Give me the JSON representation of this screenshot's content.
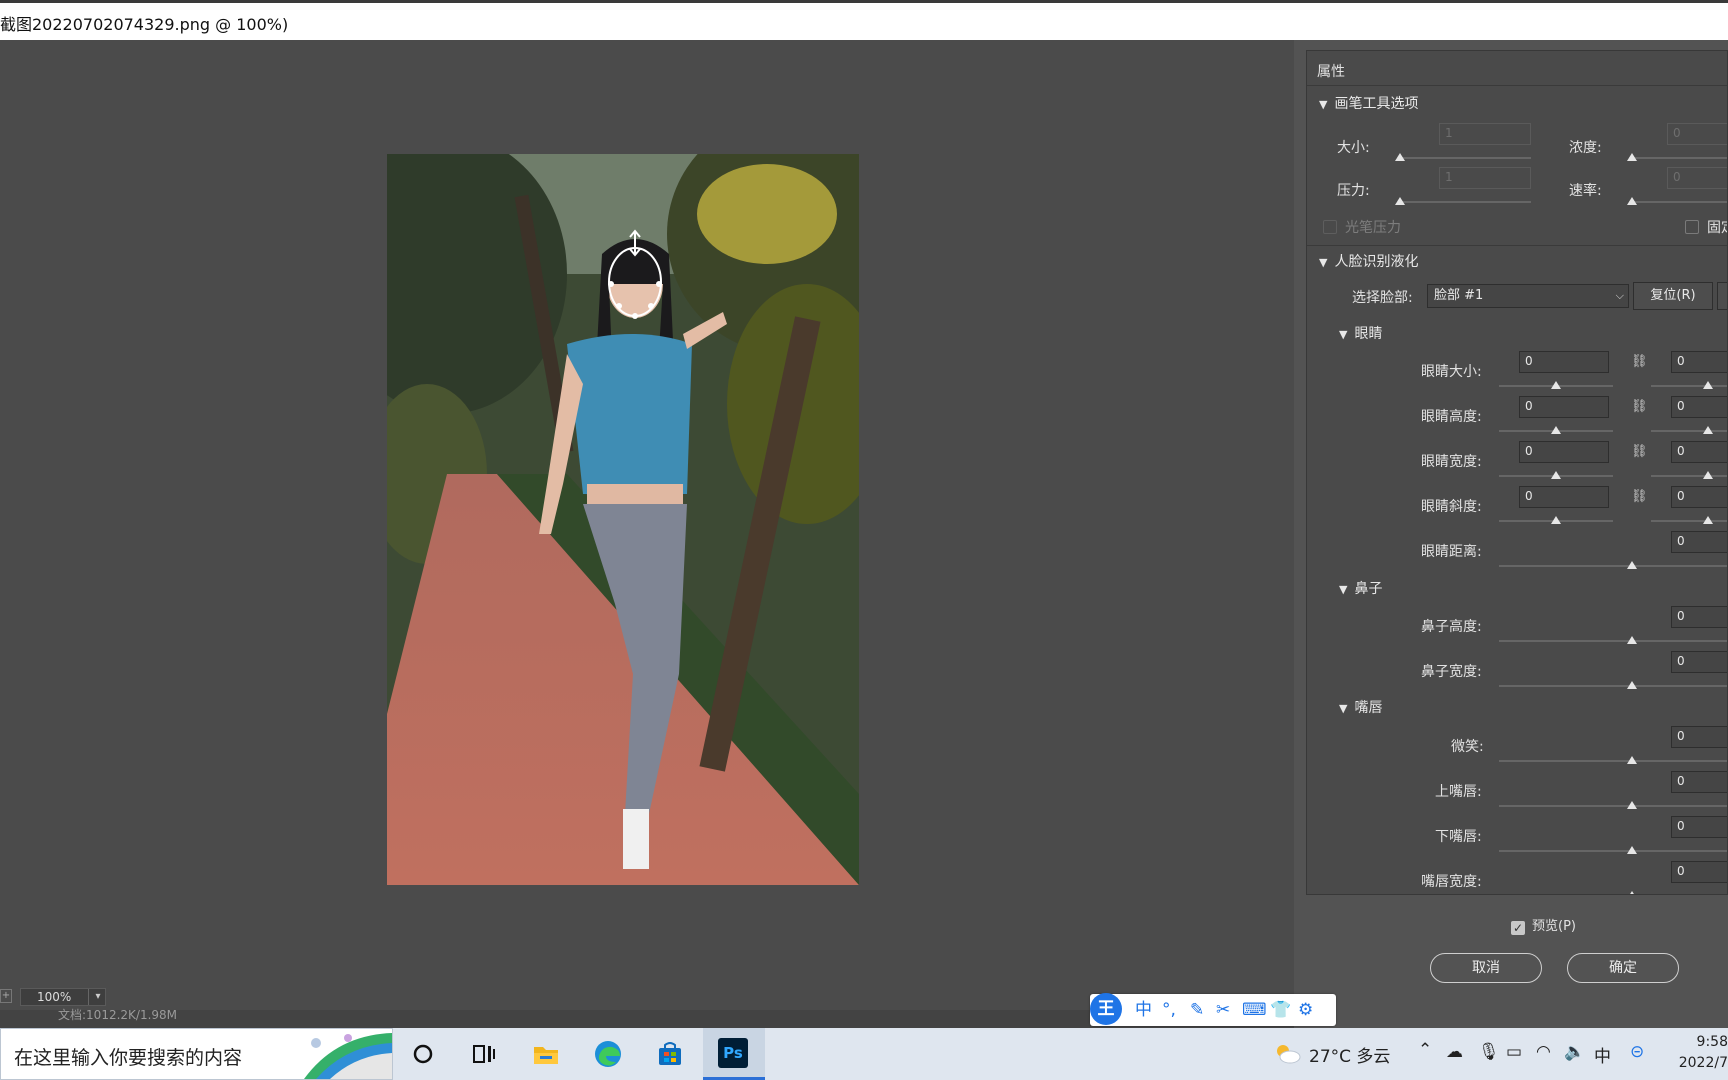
{
  "window": {
    "title": "截图20220702074329.png @ 100%)"
  },
  "canvas": {
    "zoom": "100%",
    "doc_status": "文档:1012.2K/1.98M"
  },
  "panel": {
    "header": "属性",
    "brush_section": {
      "title": "画笔工具选项",
      "size_label": "大小:",
      "size_value": "1",
      "density_label": "浓度:",
      "density_value": "0",
      "pressure_label": "压力:",
      "pressure_value": "1",
      "rate_label": "速率:",
      "rate_value": "0",
      "stylus_pressure": "光笔压力",
      "pin_label": "固定"
    },
    "face_section": {
      "title": "人脸识别液化",
      "select_face_label": "选择脸部:",
      "select_face_value": "脸部 #1",
      "reset_label": "复位(R)"
    },
    "eyes": {
      "title": "眼睛",
      "rows": [
        {
          "label": "眼睛大小:",
          "left": "0",
          "right": "0"
        },
        {
          "label": "眼睛高度:",
          "left": "0",
          "right": "0"
        },
        {
          "label": "眼睛宽度:",
          "left": "0",
          "right": "0"
        },
        {
          "label": "眼睛斜度:",
          "left": "0",
          "right": "0"
        }
      ],
      "distance_label": "眼睛距离:",
      "distance_value": "0"
    },
    "nose": {
      "title": "鼻子",
      "rows": [
        {
          "label": "鼻子高度:",
          "value": "0"
        },
        {
          "label": "鼻子宽度:",
          "value": "0"
        }
      ]
    },
    "mouth": {
      "title": "嘴唇",
      "rows": [
        {
          "label": "微笑:",
          "value": "0"
        },
        {
          "label": "上嘴唇:",
          "value": "0"
        },
        {
          "label": "下嘴唇:",
          "value": "0"
        },
        {
          "label": "嘴唇宽度:",
          "value": "0"
        }
      ]
    }
  },
  "dialog": {
    "preview_label": "预览(P)",
    "preview_checked": true,
    "cancel_label": "取消",
    "ok_label": "确定"
  },
  "ime": {
    "logo": "王",
    "lang": "中"
  },
  "taskbar": {
    "search_placeholder": "在这里输入你要搜索的内容",
    "ps_label": "Ps",
    "weather": "27°C 多云",
    "ime_indicator": "中",
    "time": "9:58",
    "date": "2022/7"
  },
  "colors": {
    "panel_bg": "#4a4a4a",
    "workspace_bg": "#4b4b4b",
    "taskbar_bg": "#dfe6ef",
    "ime_accent": "#1f74e6",
    "ps_icon_bg": "#001e36",
    "ps_icon_fg": "#31a8ff"
  }
}
